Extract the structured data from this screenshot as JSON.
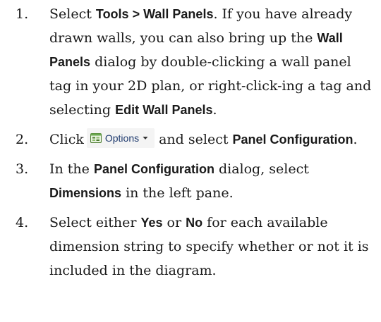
{
  "steps": [
    {
      "number": "1.",
      "t1": "Select ",
      "b1": "Tools > Wall Panels",
      "t2": ". If you have already drawn walls, you can also bring up the ",
      "b2": "Wall Panels",
      "t3": " dialog by double-clicking a wall panel tag in your 2D plan, or right-click-ing a tag and selecting ",
      "b3": "Edit Wall Panels",
      "t4": "."
    },
    {
      "number": "2.",
      "t1": "Click",
      "button_label": "Options",
      "button_icon": "options-icon",
      "t2": "and select ",
      "b1": "Panel Configuration",
      "t3": "."
    },
    {
      "number": "3.",
      "t1": "In the ",
      "b1": "Panel Configuration",
      "t2": " dialog, select ",
      "b2": "Dimensions",
      "t3": " in the left pane."
    },
    {
      "number": "4.",
      "t1": "Select either ",
      "b1": "Yes",
      "t2": " or ",
      "b2": "No",
      "t3": " for each available dimension string to specify whether or not it is included in the diagram."
    }
  ],
  "colors": {
    "text": "#1a1a1a",
    "button_bg": "#f4f4f4",
    "button_text": "#1e3a6e"
  }
}
